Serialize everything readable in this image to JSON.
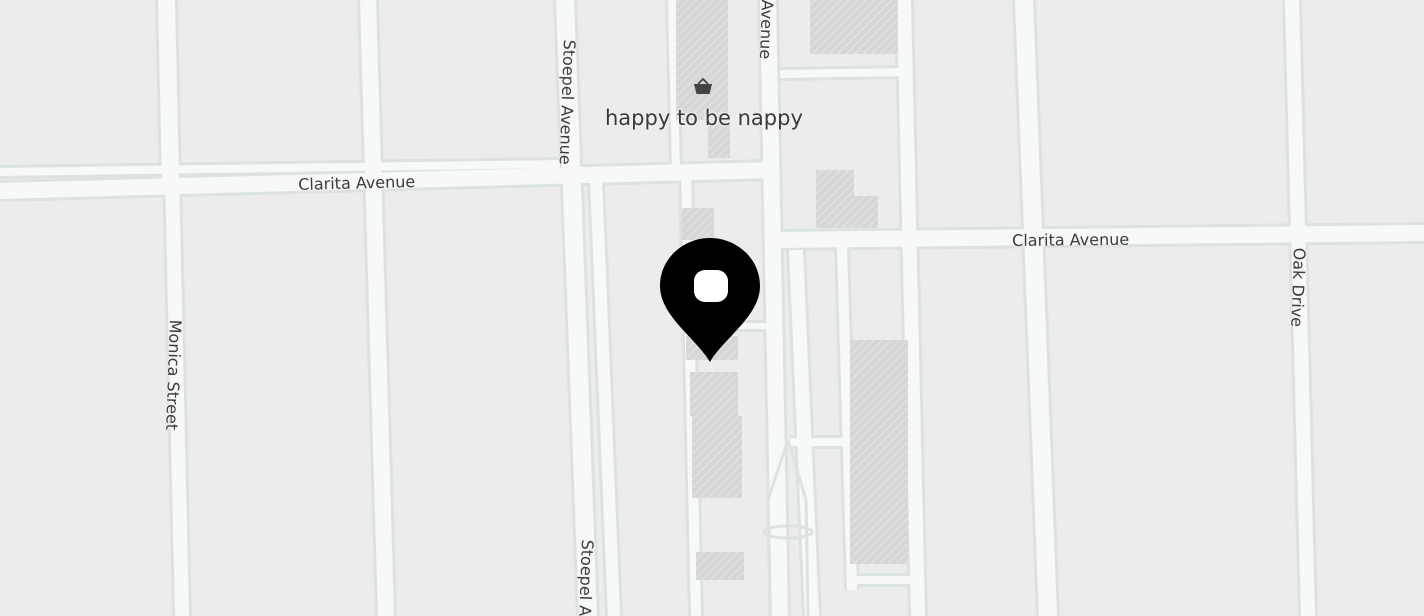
{
  "map": {
    "streets": [
      {
        "id": "clarita-avenue-west",
        "label": "Clarita Avenue"
      },
      {
        "id": "clarita-avenue-east",
        "label": "Clarita Avenue"
      },
      {
        "id": "stoepel-avenue-north",
        "label": "Stoepel Avenue"
      },
      {
        "id": "stoepel-avenue-south",
        "label": "Stoepel A"
      },
      {
        "id": "monica-street",
        "label": "Monica Street"
      },
      {
        "id": "oak-drive",
        "label": "Oak Drive"
      },
      {
        "id": "avenue-top",
        "label": "Avenue"
      }
    ],
    "poi": {
      "label": "happy to be nappy",
      "icon": "shopping-basket-icon"
    },
    "marker": {
      "icon": "location-pin-icon",
      "color": "#000000"
    },
    "colors": {
      "land": "#ededed",
      "road": "#f7f8f8",
      "road_edge": "#dbe2e1",
      "building": "#dadada"
    }
  }
}
